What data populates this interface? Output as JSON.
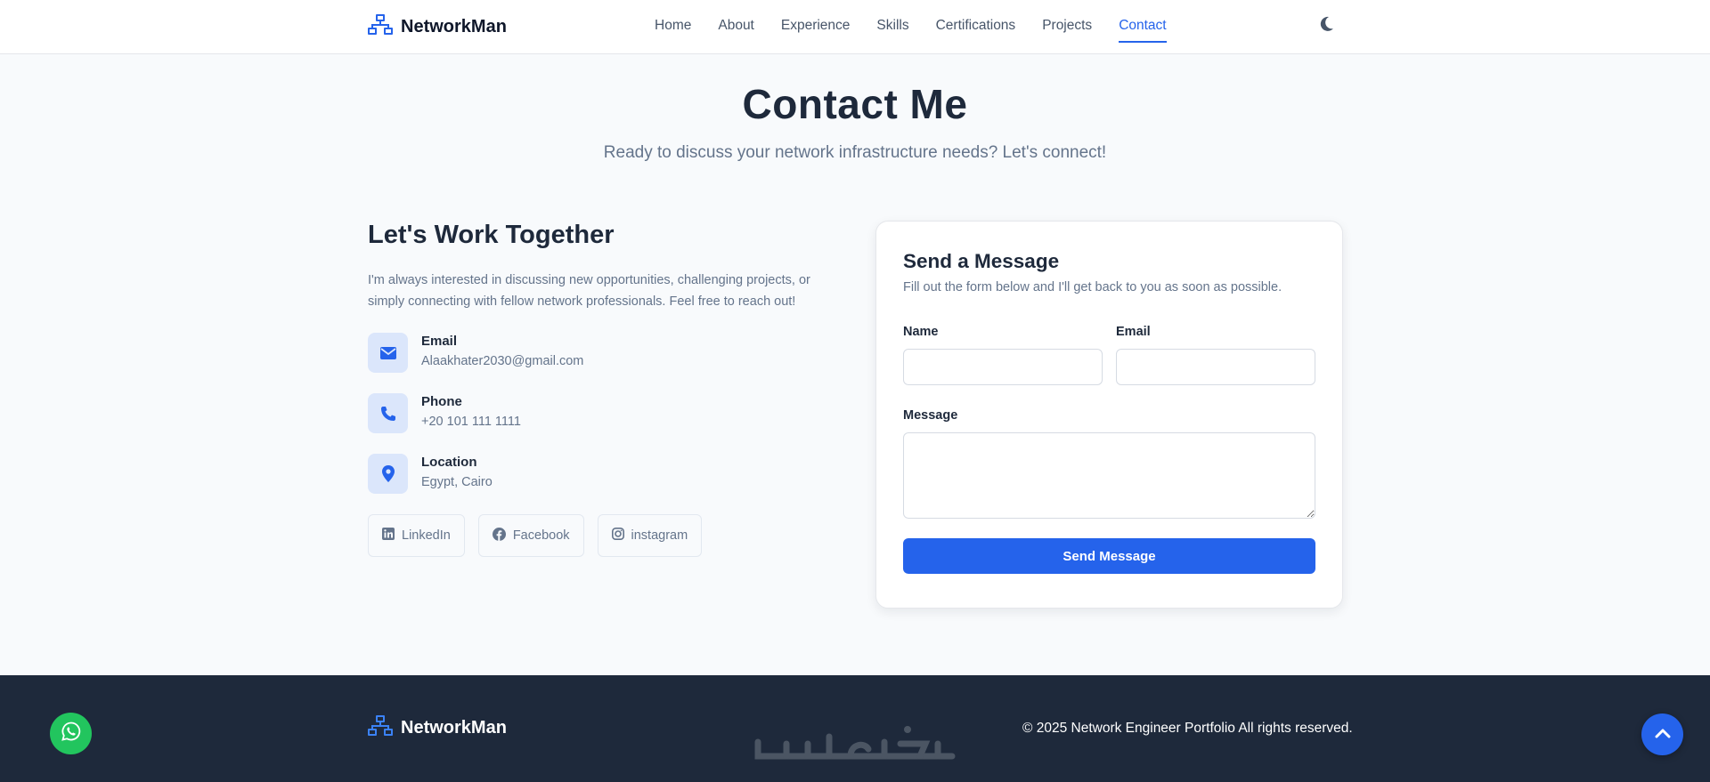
{
  "header": {
    "brand": "NetworkMan",
    "nav": [
      "Home",
      "About",
      "Experience",
      "Skills",
      "Certifications",
      "Projects",
      "Contact"
    ],
    "active_nav": "Contact",
    "theme_icon": "moon-icon"
  },
  "hero": {
    "title": "Contact Me",
    "subtitle": "Ready to discuss your network infrastructure needs? Let's connect!"
  },
  "left": {
    "heading": "Let's Work Together",
    "intro": "I'm always interested in discussing new opportunities, challenging projects, or simply connecting with fellow network professionals. Feel free to reach out!",
    "contacts": [
      {
        "icon": "envelope-icon",
        "label": "Email",
        "value": "Alaakhater2030@gmail.com"
      },
      {
        "icon": "phone-icon",
        "label": "Phone",
        "value": "+20 101 111 1111"
      },
      {
        "icon": "map-pin-icon",
        "label": "Location",
        "value": "Egypt, Cairo"
      }
    ],
    "socials": [
      {
        "icon": "linkedin-icon",
        "label": "LinkedIn"
      },
      {
        "icon": "facebook-icon",
        "label": "Facebook"
      },
      {
        "icon": "instagram-icon",
        "label": "instagram"
      }
    ]
  },
  "form": {
    "title": "Send a Message",
    "subtitle": "Fill out the form below and I'll get back to you as soon as possible.",
    "name_label": "Name",
    "name_value": "",
    "email_label": "Email",
    "email_value": "",
    "message_label": "Message",
    "message_value": "",
    "submit_label": "Send Message"
  },
  "footer": {
    "brand": "NetworkMan",
    "copyright": "© 2025 Network Engineer Portfolio All rights reserved.",
    "watermark": "خمسات"
  },
  "colors": {
    "accent": "#2563eb",
    "footer_bg": "#1e293b",
    "whatsapp": "#22c55e"
  }
}
